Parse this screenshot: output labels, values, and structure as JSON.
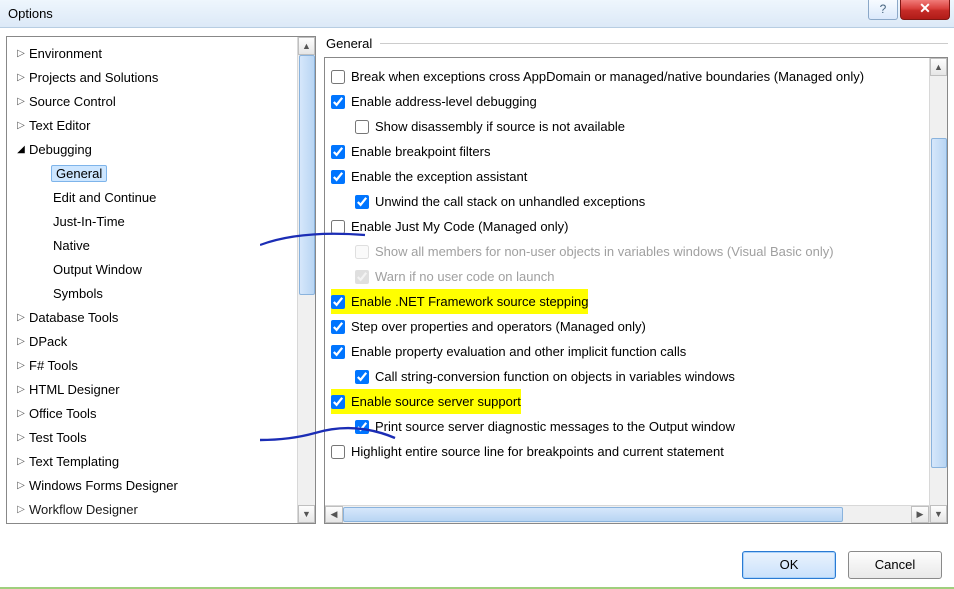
{
  "window": {
    "title": "Options"
  },
  "buttons": {
    "ok": "OK",
    "cancel": "Cancel"
  },
  "group": {
    "title": "General"
  },
  "tree": {
    "environment": "Environment",
    "projects": "Projects and Solutions",
    "source_control": "Source Control",
    "text_editor": "Text Editor",
    "debugging": "Debugging",
    "debugging_children": {
      "general": "General",
      "edit_continue": "Edit and Continue",
      "jit": "Just-In-Time",
      "native": "Native",
      "output": "Output Window",
      "symbols": "Symbols"
    },
    "db_tools": "Database Tools",
    "dpack": "DPack",
    "fsharp": "F# Tools",
    "html": "HTML Designer",
    "office": "Office Tools",
    "test": "Test Tools",
    "templating": "Text Templating",
    "winforms": "Windows Forms Designer",
    "workflow": "Workflow Designer"
  },
  "opts": {
    "break_appdomain": {
      "label": "Break when exceptions cross AppDomain or managed/native boundaries (Managed only)",
      "checked": false,
      "disabled": false
    },
    "addr_dbg": {
      "label": "Enable address-level debugging",
      "checked": true,
      "disabled": false
    },
    "show_disasm": {
      "label": "Show disassembly if source is not available",
      "checked": false,
      "disabled": false
    },
    "bp_filters": {
      "label": "Enable breakpoint filters",
      "checked": true,
      "disabled": false
    },
    "exc_assist": {
      "label": "Enable the exception assistant",
      "checked": true,
      "disabled": false
    },
    "unwind": {
      "label": "Unwind the call stack on unhandled exceptions",
      "checked": true,
      "disabled": false
    },
    "just_my_code": {
      "label": "Enable Just My Code (Managed only)",
      "checked": false,
      "disabled": false
    },
    "show_nonuser": {
      "label": "Show all members for non-user objects in variables windows (Visual Basic only)",
      "checked": false,
      "disabled": true
    },
    "warn_nocode": {
      "label": "Warn if no user code on launch",
      "checked": true,
      "disabled": true
    },
    "net_src_step": {
      "label": "Enable .NET Framework source stepping",
      "checked": true,
      "disabled": false,
      "highlight": true
    },
    "step_over_props": {
      "label": "Step over properties and operators (Managed only)",
      "checked": true,
      "disabled": false
    },
    "prop_eval": {
      "label": "Enable property evaluation and other implicit function calls",
      "checked": true,
      "disabled": false
    },
    "call_stringconv": {
      "label": "Call string-conversion function on objects in variables windows",
      "checked": true,
      "disabled": false
    },
    "src_server": {
      "label": "Enable source server support",
      "checked": true,
      "disabled": false,
      "highlight": true
    },
    "src_server_diag": {
      "label": "Print source server diagnostic messages to the Output window",
      "checked": true,
      "disabled": false
    },
    "hl_src_line": {
      "label": "Highlight entire source line for breakpoints and current statement",
      "checked": false,
      "disabled": false
    }
  }
}
